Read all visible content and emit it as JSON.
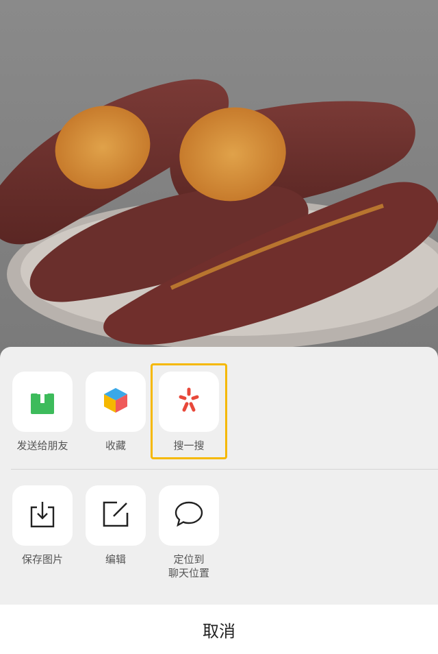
{
  "photo": {
    "subject": "sweet-potatoes-photo"
  },
  "share_sheet": {
    "row1": [
      {
        "label": "发送给朋友",
        "icon": "send-to-friend-icon"
      },
      {
        "label": "收藏",
        "icon": "favorites-cube-icon"
      },
      {
        "label": "搜一搜",
        "icon": "search-search-icon"
      }
    ],
    "row2": [
      {
        "label": "保存图片",
        "icon": "save-image-icon"
      },
      {
        "label": "编辑",
        "icon": "edit-icon"
      },
      {
        "label": "定位到\n聊天位置",
        "icon": "chat-bubble-icon"
      }
    ],
    "cancel_label": "取消"
  },
  "colors": {
    "highlight": "#f5b800",
    "send_green": "#3dbb5b",
    "search_red": "#e8483a"
  }
}
